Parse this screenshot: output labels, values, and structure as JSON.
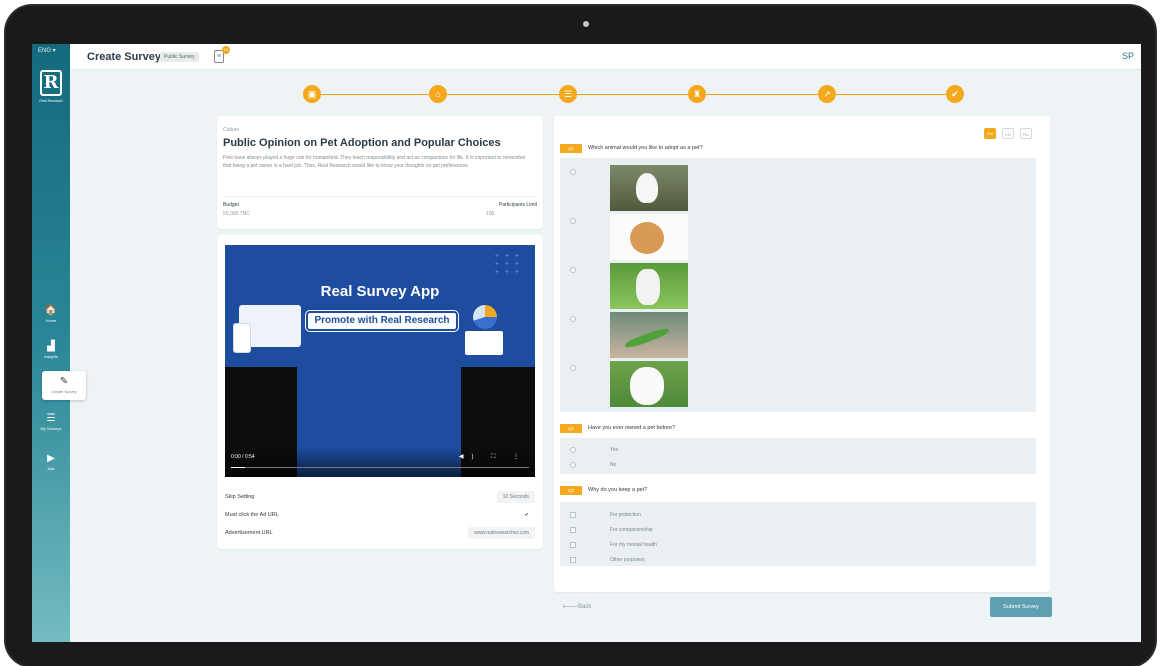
{
  "sidebar": {
    "lang": "ENG ▾",
    "logo_text": "Real Research",
    "items": [
      {
        "label": "Home",
        "icon": "home-icon"
      },
      {
        "label": "Insights",
        "icon": "insights-icon"
      },
      {
        "label": "Create Survey",
        "icon": "pencil-icon"
      },
      {
        "label": "My Surveys",
        "icon": "list-icon"
      },
      {
        "label": "Ads",
        "icon": "play-icon"
      }
    ]
  },
  "header": {
    "title": "Create Survey",
    "badge": "Public Survey",
    "notif_count": "10",
    "avatar": "SP"
  },
  "colors": {
    "accent": "#f4a81d",
    "brand": "#1e6f82",
    "submit": "#5f9fb2"
  },
  "survey": {
    "category": "Culture",
    "title": "Public Opinion on Pet Adoption and Popular Choices",
    "description": "Pets have always played a huge role for humankind. They teach responsibility and act as companions for life. It is important to remember that being a pet owner is a hard job. Thus, Real Research would like to know your thoughts on pet preferences.",
    "budget_label": "Budget",
    "budget_value": "50,000 TNC",
    "limit_label": "Participants Limit",
    "limit_value": "100"
  },
  "ad": {
    "banner_title": "Real Survey App",
    "banner_subtitle": "Promote with Real Research",
    "video_time": "0:00 / 0:54",
    "skip_label": "Skip Setting",
    "skip_value": "10 Seconds",
    "must_click_label": "Must click the Ad URL",
    "must_click_value": "✔",
    "url_label": "Advertisement URL",
    "url_value": "www.realresearcher.com"
  },
  "languages": [
    "EN",
    "KO",
    "RU"
  ],
  "questions": [
    {
      "num": "Q1",
      "text": "Which animal would you like to adopt as a pet?",
      "options": [
        "rabbit",
        "hamster",
        "kitten",
        "lizard",
        "puppy"
      ]
    },
    {
      "num": "Q2",
      "text": "Have you ever owned a pet before?",
      "options": [
        "Yes",
        "No"
      ]
    },
    {
      "num": "Q3",
      "text": "Why do you keep a pet?",
      "options": [
        "For protection",
        "For companionship",
        "For my mental health",
        "Other purposes"
      ]
    }
  ],
  "footer": {
    "back": "🡐Back",
    "submit": "Submit Survey"
  }
}
